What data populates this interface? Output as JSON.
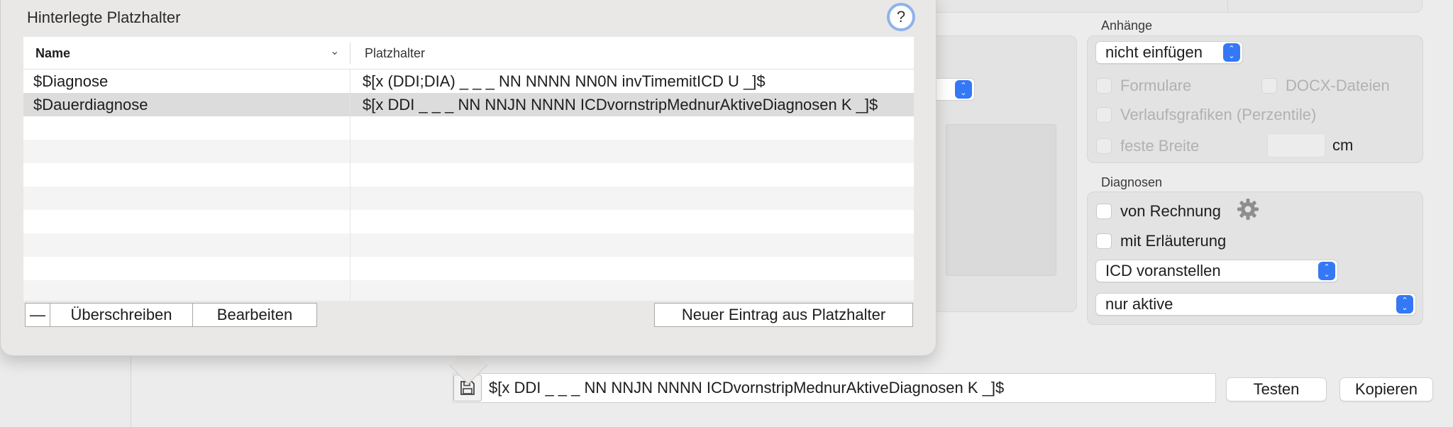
{
  "popover": {
    "title": "Hinterlegte Platzhalter",
    "help_label": "?",
    "columns": {
      "name": "Name",
      "placeholder": "Platzhalter"
    },
    "rows": [
      {
        "name": "$Diagnose",
        "placeholder": "$[x (DDI;DIA) _ _ _ NN NNNN NN0N invTimemitICD U _]$"
      },
      {
        "name": "$Dauerdiagnose",
        "placeholder": "$[x DDI _ _ _ NN NNJN NNNN ICDvornstripMednurAktiveDiagnosen K _]$",
        "selected": true
      }
    ],
    "buttons": {
      "remove": "—",
      "overwrite": "Überschreiben",
      "edit": "Bearbeiten",
      "new_entry": "Neuer Eintrag aus Platzhalter"
    }
  },
  "anhaenge": {
    "title": "Anhänge",
    "select_value": "nicht einfügen",
    "formulare": "Formulare",
    "docx": "DOCX-Dateien",
    "verlauf": "Verlaufsgrafiken (Perzentile)",
    "feste_breite": "feste Breite",
    "unit": "cm"
  },
  "diagnosen": {
    "title": "Diagnosen",
    "von_rechnung": "von Rechnung",
    "mit_erlaeuterung": "mit Erläuterung",
    "icd_select": "ICD voranstellen",
    "filter_select": "nur aktive"
  },
  "bottom": {
    "input_value": "$[x DDI _ _ _ NN NNJN NNNN ICDvornstripMednurAktiveDiagnosen K _]$",
    "test_button": "Testen",
    "copy_button": "Kopieren"
  },
  "colors": {
    "accent": "#3478f6",
    "help_ring": "#8fb2ec"
  }
}
